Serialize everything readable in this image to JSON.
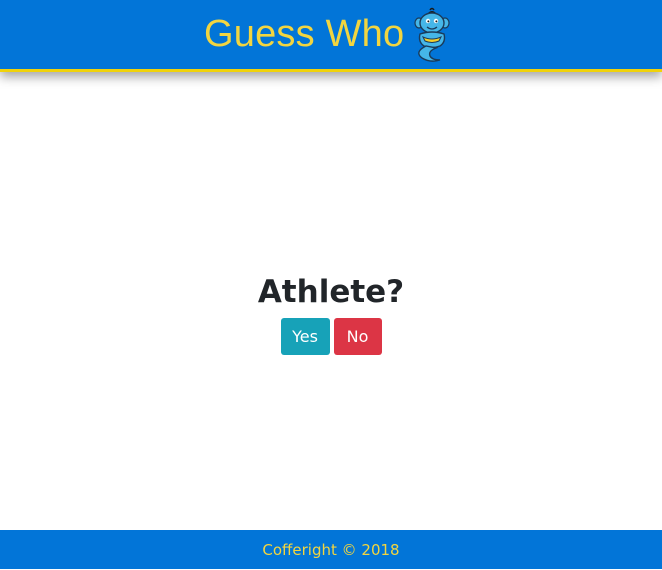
{
  "header": {
    "title": "Guess Who",
    "logo_icon": "genie-icon"
  },
  "main": {
    "question": "Athlete?",
    "yes_label": "Yes",
    "no_label": "No"
  },
  "footer": {
    "copyright": "Cofferight © 2018"
  },
  "colors": {
    "brand_blue": "#0275d8",
    "accent_yellow": "#f2d540",
    "yes_button": "#17a2b8",
    "no_button": "#dc3545"
  }
}
